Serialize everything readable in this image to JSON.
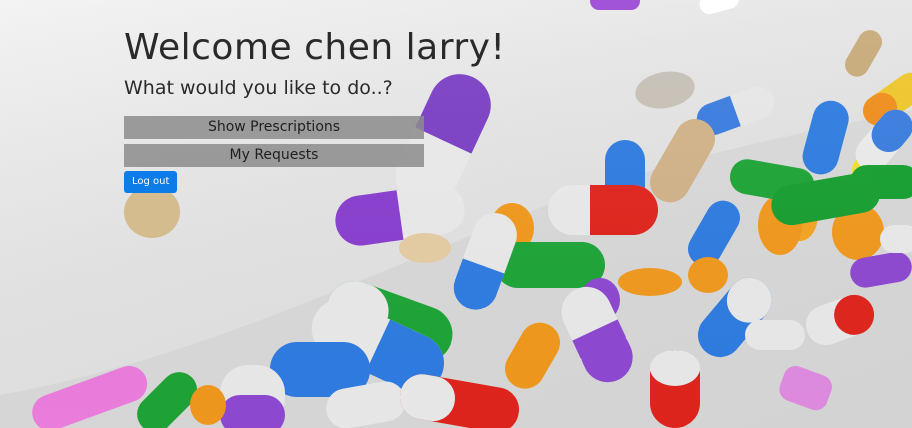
{
  "header": {
    "welcome": "Welcome chen larry!",
    "prompt": "What would you like to do..?"
  },
  "actions": {
    "show_prescriptions": "Show Prescriptions",
    "my_requests": "My Requests",
    "logout": "Log out"
  },
  "colors": {
    "logout_button": "#0b7ce8",
    "menu_button": "#8c8c8c"
  }
}
